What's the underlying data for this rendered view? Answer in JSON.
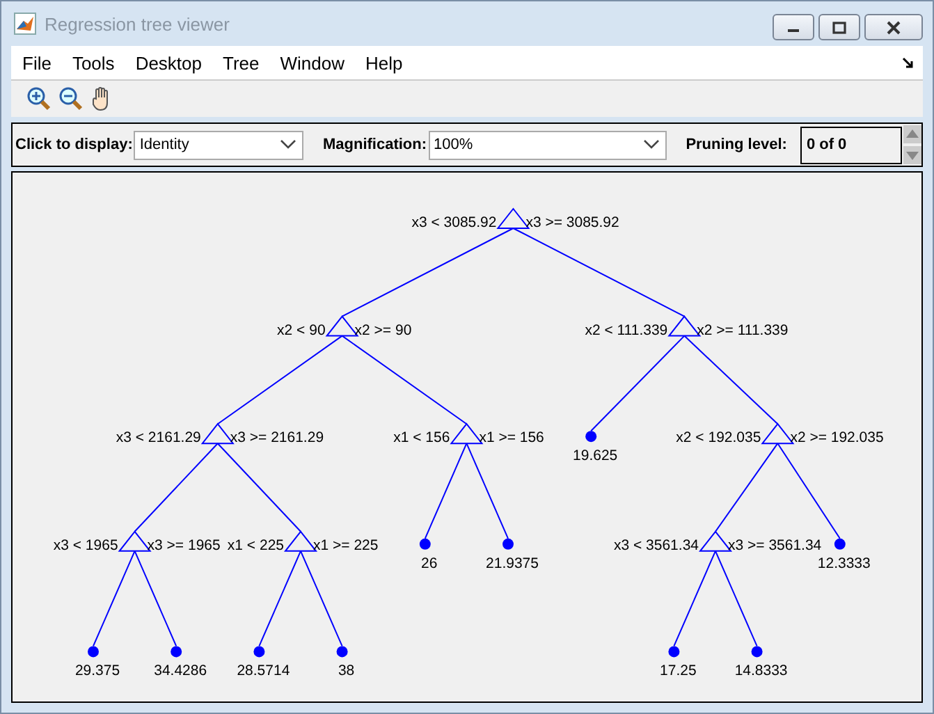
{
  "window": {
    "title": "Regression tree viewer"
  },
  "menu": [
    "File",
    "Tools",
    "Desktop",
    "Tree",
    "Window",
    "Help"
  ],
  "controls": {
    "display": {
      "label": "Click to display:",
      "value": "Identity"
    },
    "magnification": {
      "label": "Magnification:",
      "value": "100%"
    },
    "pruning": {
      "label": "Pruning level:",
      "value": "0 of 0"
    }
  },
  "tree": {
    "kind": "split",
    "left_label": "x3 < 3085.92",
    "right_label": "x3 >= 3085.92",
    "children": [
      {
        "kind": "split",
        "left_label": "x2 < 90",
        "right_label": "x2 >= 90",
        "children": [
          {
            "kind": "split",
            "left_label": "x3 < 2161.29",
            "right_label": "x3 >= 2161.29",
            "children": [
              {
                "kind": "split",
                "left_label": "x3 < 1965",
                "right_label": "x3 >= 1965",
                "children": [
                  {
                    "kind": "leaf",
                    "value": "29.375"
                  },
                  {
                    "kind": "leaf",
                    "value": "34.4286"
                  }
                ]
              },
              {
                "kind": "split",
                "left_label": "x1 < 225",
                "right_label": "x1 >= 225",
                "children": [
                  {
                    "kind": "leaf",
                    "value": "28.5714"
                  },
                  {
                    "kind": "leaf",
                    "value": "38"
                  }
                ]
              }
            ]
          },
          {
            "kind": "split",
            "left_label": "x1 < 156",
            "right_label": "x1 >= 156",
            "children": [
              {
                "kind": "leaf",
                "value": "26"
              },
              {
                "kind": "leaf",
                "value": "21.9375"
              }
            ]
          }
        ]
      },
      {
        "kind": "split",
        "left_label": "x2 < 111.339",
        "right_label": "x2 >= 111.339",
        "children": [
          {
            "kind": "leaf",
            "value": "19.625"
          },
          {
            "kind": "split",
            "left_label": "x2 < 192.035",
            "right_label": "x2 >= 192.035",
            "children": [
              {
                "kind": "split",
                "left_label": "x3 < 3561.34",
                "right_label": "x3 >= 3561.34",
                "children": [
                  {
                    "kind": "leaf",
                    "value": "17.25"
                  },
                  {
                    "kind": "leaf",
                    "value": "14.8333"
                  }
                ]
              },
              {
                "kind": "leaf",
                "value": "12.3333"
              }
            ]
          }
        ]
      }
    ]
  }
}
